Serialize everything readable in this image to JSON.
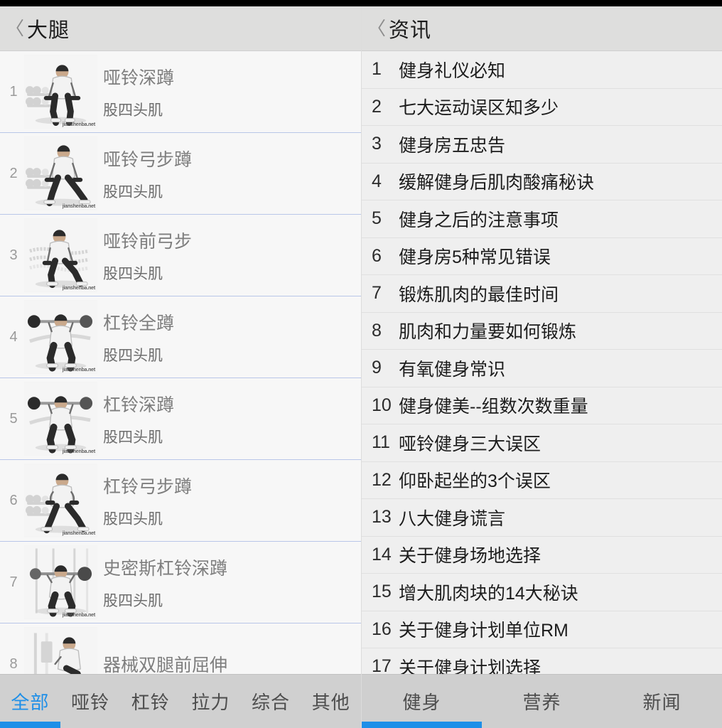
{
  "colors": {
    "accent": "#1e8fe8",
    "titlebar_bg": "#dededd",
    "left_pane_bg": "#f7f7f7",
    "right_pane_bg": "#efefef",
    "left_separator": "#b9c6e8",
    "right_separator": "#e0e0e0",
    "tabbar_bg": "#d0d0d0",
    "status_bar": "#000000"
  },
  "left_pane": {
    "header": {
      "back_icon": "〈",
      "title": "大腿"
    },
    "exercises": [
      {
        "index": "1",
        "title": "哑铃深蹲",
        "muscle": "股四头肌",
        "watermark": "jianshenba.net",
        "art": "dumbbell-squat"
      },
      {
        "index": "2",
        "title": "哑铃弓步蹲",
        "muscle": "股四头肌",
        "watermark": "jianshenba.net",
        "art": "dumbbell-lunge"
      },
      {
        "index": "3",
        "title": "哑铃前弓步",
        "muscle": "股四头肌",
        "watermark": "jianshenba.net",
        "art": "dumbbell-front-lunge"
      },
      {
        "index": "4",
        "title": "杠铃全蹲",
        "muscle": "股四头肌",
        "watermark": "jianshenba.net",
        "art": "barbell-full-squat"
      },
      {
        "index": "5",
        "title": "杠铃深蹲",
        "muscle": "股四头肌",
        "watermark": "jianshenba.net",
        "art": "barbell-squat"
      },
      {
        "index": "6",
        "title": "杠铃弓步蹲",
        "muscle": "股四头肌",
        "watermark": "jianshenba.net",
        "art": "barbell-lunge"
      },
      {
        "index": "7",
        "title": "史密斯杠铃深蹲",
        "muscle": "股四头肌",
        "watermark": "jianshenba.net",
        "art": "smith-machine-squat"
      },
      {
        "index": "8",
        "title": "器械双腿前屈伸",
        "muscle": "",
        "watermark": "",
        "art": "leg-extension-machine"
      }
    ],
    "tabs": [
      {
        "label": "全部",
        "active": true
      },
      {
        "label": "哑铃",
        "active": false
      },
      {
        "label": "杠铃",
        "active": false
      },
      {
        "label": "拉力",
        "active": false
      },
      {
        "label": "综合",
        "active": false
      },
      {
        "label": "其他",
        "active": false
      }
    ]
  },
  "right_pane": {
    "header": {
      "back_icon": "〈",
      "title": "资讯"
    },
    "articles": [
      {
        "index": "1",
        "title": "健身礼仪必知"
      },
      {
        "index": "2",
        "title": "七大运动误区知多少"
      },
      {
        "index": "3",
        "title": "健身房五忠告"
      },
      {
        "index": "4",
        "title": "缓解健身后肌肉酸痛秘诀"
      },
      {
        "index": "5",
        "title": "健身之后的注意事项"
      },
      {
        "index": "6",
        "title": "健身房5种常见错误"
      },
      {
        "index": "7",
        "title": "锻炼肌肉的最佳时间"
      },
      {
        "index": "8",
        "title": "肌肉和力量要如何锻炼"
      },
      {
        "index": "9",
        "title": "有氧健身常识"
      },
      {
        "index": "10",
        "title": "健身健美--组数次数重量"
      },
      {
        "index": "11",
        "title": "哑铃健身三大误区"
      },
      {
        "index": "12",
        "title": "仰卧起坐的3个误区"
      },
      {
        "index": "13",
        "title": "八大健身谎言"
      },
      {
        "index": "14",
        "title": "关于健身场地选择"
      },
      {
        "index": "15",
        "title": "增大肌肉块的14大秘诀"
      },
      {
        "index": "16",
        "title": "关于健身计划单位RM"
      },
      {
        "index": "17",
        "title": "关于健身计划选择"
      }
    ],
    "tabs": [
      {
        "label": "健身",
        "active": true
      },
      {
        "label": "营养",
        "active": false
      },
      {
        "label": "新闻",
        "active": false
      }
    ]
  }
}
